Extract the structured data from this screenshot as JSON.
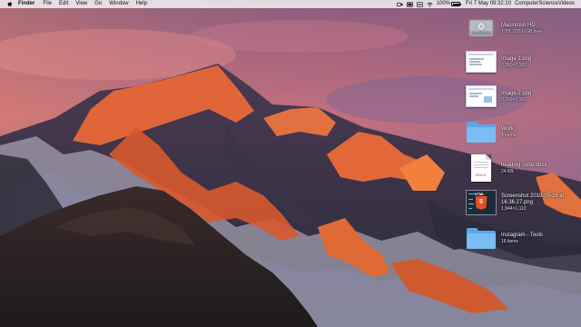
{
  "menubar": {
    "app_name": "Finder",
    "menus": [
      "File",
      "Edit",
      "View",
      "Go",
      "Window",
      "Help"
    ],
    "battery_text": "100%",
    "battery_level": 1.0,
    "clock": "Fri 7 May  09:32:10",
    "user": "ComputerScienceVideos",
    "status_icons": [
      "camera-icon",
      "graphics-icon",
      "teamviewer-icon",
      "wifi-icon"
    ]
  },
  "desktop": {
    "icons": [
      {
        "name": "Macintosh HD",
        "info": "1 TB, 320.6 GB free",
        "icon": "hard-drive-icon"
      },
      {
        "name": "Image 1.png",
        "info": "3,360×2,100",
        "icon": "screenshot-thumbnail"
      },
      {
        "name": "Image 2.png",
        "info": "3,360×2,100",
        "icon": "screenshot-thumbnail"
      },
      {
        "name": "Work",
        "info": "4 items",
        "icon": "folder-icon"
      },
      {
        "name": "heading code.docx",
        "info": "24 KB",
        "icon": "docx-document-icon"
      },
      {
        "name": "Screenshot 2019-05-28 at 16.36.27.png",
        "info": "1,944×1,112",
        "icon": "html5-screenshot-thumbnail"
      },
      {
        "name": "Instagram - Tools",
        "info": "16 items",
        "icon": "folder-icon"
      }
    ],
    "doc_ext": "DOCX",
    "code_badge": "5",
    "code_label": "HTML"
  },
  "colors": {
    "folder_blue": "#6fb8f0",
    "sky_top": "#7a6a8e",
    "sky_glow": "#e08a6a",
    "peak_lit": "#e0663a"
  }
}
